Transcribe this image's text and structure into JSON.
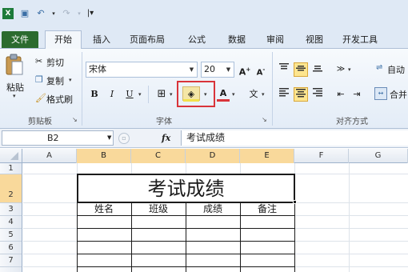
{
  "ribbon_tabs": [
    {
      "label": "文件"
    },
    {
      "label": "开始"
    },
    {
      "label": "插入"
    },
    {
      "label": "页面布局"
    },
    {
      "label": "公式"
    },
    {
      "label": "数据"
    },
    {
      "label": "审阅"
    },
    {
      "label": "视图"
    },
    {
      "label": "开发工具"
    }
  ],
  "clipboard": {
    "paste": "粘贴",
    "cut": "剪切",
    "copy": "复制",
    "format_painter": "格式刷",
    "group_label": "剪贴板"
  },
  "font": {
    "name": "宋体",
    "size": "20",
    "bold": "B",
    "italic": "I",
    "underline": "U",
    "group_label": "字体"
  },
  "alignment": {
    "group_label": "对齐方式",
    "wrap_text": "自动",
    "merge": "合并"
  },
  "formula_bar": {
    "cell_ref": "B2",
    "fx": "fx",
    "content": "考试成绩"
  },
  "columns": [
    "A",
    "B",
    "C",
    "D",
    "E",
    "F",
    "G"
  ],
  "rows": [
    "1",
    "2",
    "3",
    "4",
    "5",
    "6",
    "7"
  ],
  "sheet": {
    "title": "考试成绩",
    "headers": [
      "姓名",
      "班级",
      "成绩",
      "备注"
    ]
  },
  "colors": {
    "file_tab": "#2b6b2f",
    "highlight": "#d9343a",
    "selected_header": "#f9d99b"
  }
}
